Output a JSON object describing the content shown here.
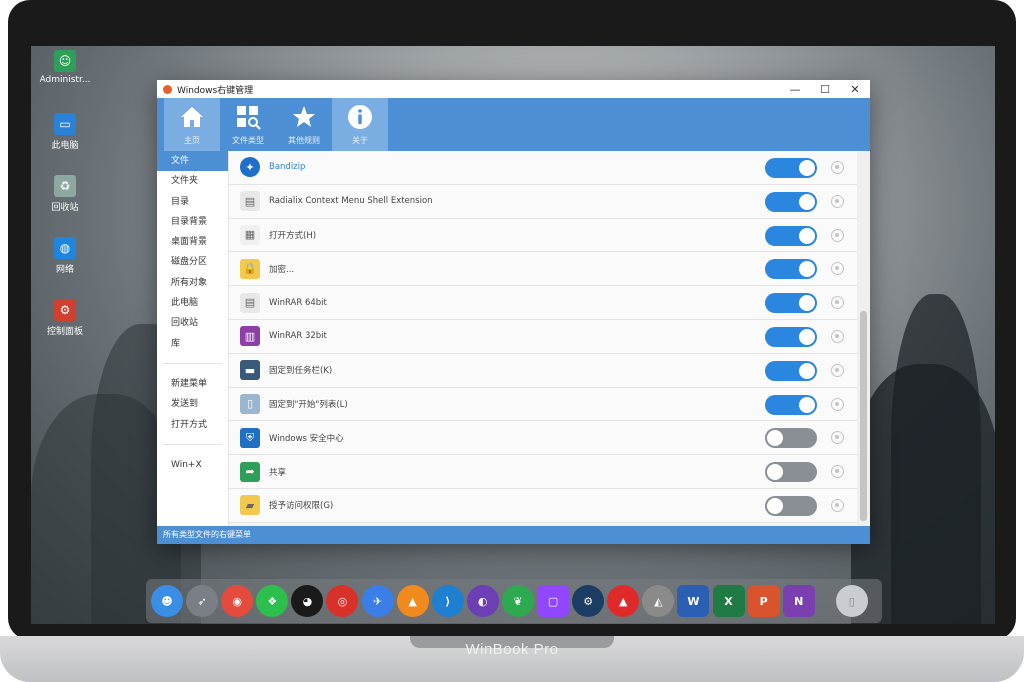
{
  "device": {
    "brand": "WinBook Pro"
  },
  "desktop_icons": [
    {
      "label": "Administr...",
      "icon": "user-icon",
      "color": "#2e9f58"
    },
    {
      "label": "此电脑",
      "icon": "computer-icon",
      "color": "#2a82d6"
    },
    {
      "label": "回收站",
      "icon": "recycle-bin-icon",
      "color": "#8da8a0"
    },
    {
      "label": "网络",
      "icon": "network-icon",
      "color": "#1f86e0"
    },
    {
      "label": "控制面板",
      "icon": "control-panel-icon",
      "color": "#d0402e"
    }
  ],
  "window": {
    "title": "Windows右键管理",
    "controls": {
      "minimize": "—",
      "maximize": "☐",
      "close": "✕"
    }
  },
  "toolbar": [
    {
      "label": "主页",
      "icon": "home-icon",
      "active": true
    },
    {
      "label": "文件类型",
      "icon": "file-type-icon",
      "active": false
    },
    {
      "label": "其他规则",
      "icon": "star-icon",
      "active": false
    },
    {
      "label": "关于",
      "icon": "info-icon",
      "active": true
    }
  ],
  "sidebar": {
    "group1": [
      "文件",
      "文件夹",
      "目录",
      "目录背景",
      "桌面背景",
      "磁盘分区",
      "所有对象",
      "此电脑",
      "回收站",
      "库"
    ],
    "group2": [
      "新建菜单",
      "发送到",
      "打开方式"
    ],
    "group3": [
      "Win+X"
    ],
    "active_index": 0
  },
  "items": [
    {
      "label": "Bandizip",
      "icon": "bandizip-icon",
      "enabled": true,
      "highlight": true,
      "color": "#1d6fc9"
    },
    {
      "label": "Radialix Context Menu Shell Extension",
      "icon": "document-icon",
      "enabled": true,
      "highlight": false,
      "color": "#e8e8e8"
    },
    {
      "label": "打开方式(H)",
      "icon": "open-with-icon",
      "enabled": true,
      "highlight": false,
      "color": "#f0f0f0"
    },
    {
      "label": "加密...",
      "icon": "lock-icon",
      "enabled": true,
      "highlight": false,
      "color": "#f2c94c"
    },
    {
      "label": "WinRAR 64bit",
      "icon": "document-icon",
      "enabled": true,
      "highlight": false,
      "color": "#e8e8e8"
    },
    {
      "label": "WinRAR 32bit",
      "icon": "winrar-icon",
      "enabled": true,
      "highlight": false,
      "color": "#8d3fa8"
    },
    {
      "label": "固定到任务栏(K)",
      "icon": "taskbar-pin-icon",
      "enabled": true,
      "highlight": false,
      "color": "#3a5a7a"
    },
    {
      "label": "固定到\"开始\"列表(L)",
      "icon": "start-pin-icon",
      "enabled": true,
      "highlight": false,
      "color": "#9bb7d0"
    },
    {
      "label": "Windows 安全中心",
      "icon": "shield-icon",
      "enabled": false,
      "highlight": false,
      "color": "#1f6fc5"
    },
    {
      "label": "共享",
      "icon": "share-icon",
      "enabled": false,
      "highlight": false,
      "color": "#2e9f58"
    },
    {
      "label": "授予访问权限(G)",
      "icon": "folder-access-icon",
      "enabled": false,
      "highlight": false,
      "color": "#f2c94c"
    }
  ],
  "status": "所有类型文件的右键菜单",
  "dock": [
    {
      "icon": "finder-icon",
      "color": "#3a8ee6"
    },
    {
      "icon": "launchpad-icon",
      "color": "#7a7f86"
    },
    {
      "icon": "chrome-icon",
      "color": "#e54b3c"
    },
    {
      "icon": "wechat-icon",
      "color": "#2dbf4e"
    },
    {
      "icon": "qq-icon",
      "color": "#1a1a1a"
    },
    {
      "icon": "netease-music-icon",
      "color": "#d8312a"
    },
    {
      "icon": "feishu-icon",
      "color": "#3b7ee8"
    },
    {
      "icon": "vlc-icon",
      "color": "#f08a1c"
    },
    {
      "icon": "vscode-icon",
      "color": "#1f7fd0"
    },
    {
      "icon": "github-icon",
      "color": "#6c3fb5"
    },
    {
      "icon": "evernote-icon",
      "color": "#2daa4f"
    },
    {
      "icon": "twitch-icon",
      "color": "#9146ff"
    },
    {
      "icon": "steam-icon",
      "color": "#1b3c63"
    },
    {
      "icon": "adobe-icon",
      "color": "#e02a2a"
    },
    {
      "icon": "rhino-icon",
      "color": "#8a8a8a"
    },
    {
      "icon": "word-icon",
      "color": "#2b5fb4"
    },
    {
      "icon": "excel-icon",
      "color": "#1f7a44"
    },
    {
      "icon": "powerpoint-icon",
      "color": "#d9542c"
    },
    {
      "icon": "onenote-icon",
      "color": "#7b3fb0"
    },
    {
      "icon": "trash-icon",
      "color": "#c9ccd0"
    }
  ]
}
